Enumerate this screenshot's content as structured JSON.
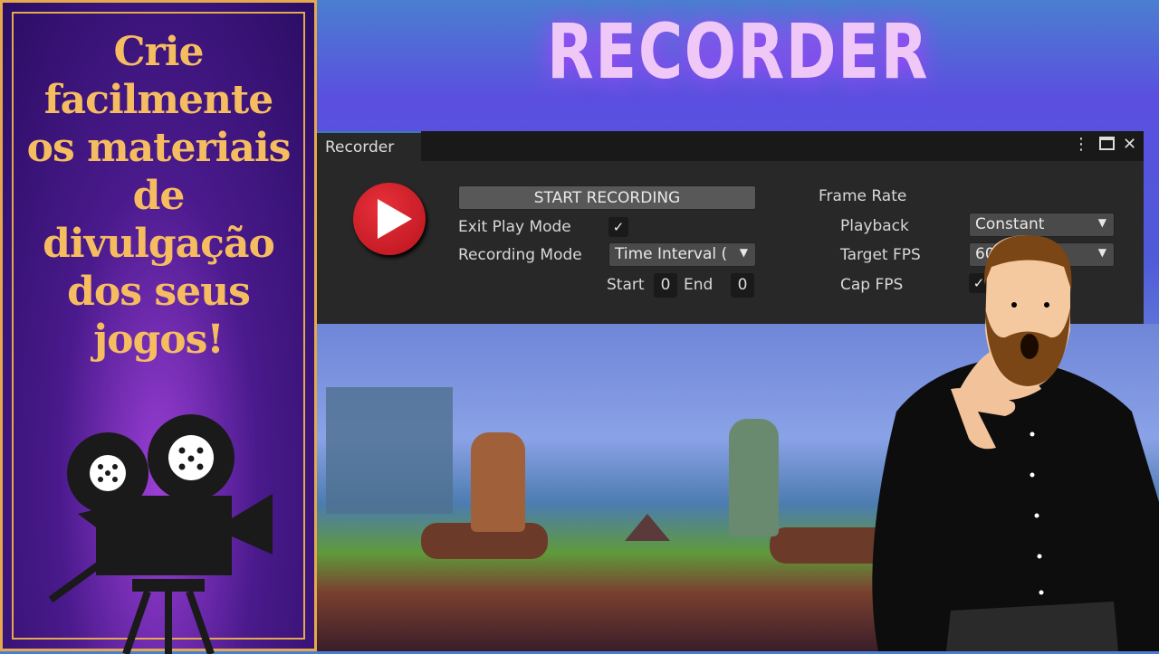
{
  "tagline": "Crie facilmente os materiais de divulgação dos seus jogos!",
  "title": "RECORDER",
  "recorder": {
    "tab": "Recorder",
    "start_button": "START RECORDING",
    "exit_play_mode_label": "Exit Play Mode",
    "exit_play_mode_checked": true,
    "recording_mode_label": "Recording Mode",
    "recording_mode_value": "Time Interval (",
    "start_label": "Start",
    "start_value": "0",
    "end_label": "End",
    "end_value": "0",
    "frame_rate_label": "Frame Rate",
    "playback_label": "Playback",
    "playback_value": "Constant",
    "target_fps_label": "Target FPS",
    "target_fps_value": "60",
    "cap_fps_label": "Cap FPS",
    "cap_fps_checked": true,
    "check_glyph": "✓"
  },
  "colors": {
    "accent_gold": "#f6bd60",
    "record_red": "#d8202a",
    "panel_bg": "#282828"
  }
}
